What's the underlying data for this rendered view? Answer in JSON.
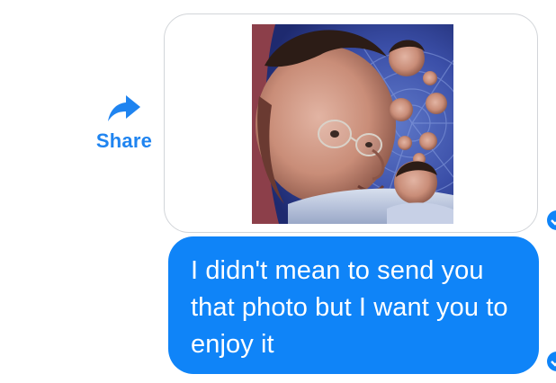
{
  "share": {
    "label": "Share",
    "icon": "share-arrow-icon"
  },
  "photo_message": {
    "icon": "image",
    "description_colors": {
      "background_swirl": "#2f3f8e",
      "skin": "#c98d78"
    }
  },
  "text_message": {
    "text": "I didn't mean to send you that photo but I want you to enjoy it"
  },
  "colors": {
    "accent": "#0f84f8",
    "share_text": "#1f84f0",
    "bubble_border": "#d2d5d9"
  },
  "status_icons": [
    "sent-check-icon",
    "sent-check-icon"
  ]
}
